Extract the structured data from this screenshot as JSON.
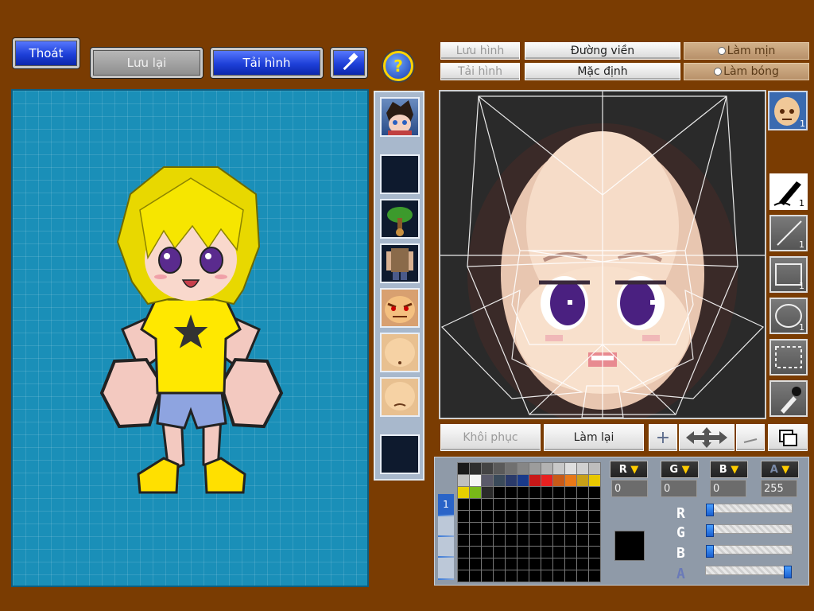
{
  "toolbar": {
    "exit_label": "Thoát",
    "save_label": "Lưu lại",
    "reload_label": "Tải hình",
    "help_symbol": "?"
  },
  "editor_toolbar": {
    "save_image_label": "Lưu hình",
    "load_image_label": "Tải hình",
    "outline_label": "Đường viền",
    "default_label": "Mặc định",
    "smooth_label": "Làm mịn",
    "shine_label": "Làm bóng"
  },
  "face_thumb_count": "1",
  "tools": [
    {
      "name": "pen",
      "count": "1"
    },
    {
      "name": "line",
      "count": "1"
    },
    {
      "name": "rectangle",
      "count": "1"
    },
    {
      "name": "ellipse",
      "count": "1"
    },
    {
      "name": "select",
      "count": ""
    },
    {
      "name": "eyedropper",
      "count": ""
    }
  ],
  "actions": {
    "restore_label": "Khôi phục",
    "redo_label": "Làm lại",
    "add_symbol": "+"
  },
  "color": {
    "r_label": "R",
    "g_label": "G",
    "b_label": "B",
    "a_label": "A",
    "r": "0",
    "g": "0",
    "b": "0",
    "a": "255",
    "r_level": 0,
    "g_level": 0,
    "b_level": 0,
    "a_level": 1,
    "current_hex": "#000000"
  },
  "palette_tab": "1",
  "palette": [
    "#1a1a1a",
    "#2e2e2e",
    "#444444",
    "#5a5a5a",
    "#707070",
    "#868686",
    "#9c9c9c",
    "#b2b2b2",
    "#c8c8c8",
    "#dedede",
    "#d0d0d0",
    "#bdbdbd",
    "#c0c0c0",
    "#f5f5f5",
    "#5a5a6a",
    "#3a4a5a",
    "#2a3a6a",
    "#1a3a8a",
    "#c81818",
    "#e82020",
    "#c85a18",
    "#e87818",
    "#c8a018",
    "#e8c800",
    "#e8d000",
    "#78b818",
    "#2a2a2a"
  ],
  "theme": {
    "background": "#7a3c02",
    "accent_blue": "#1d3fd8",
    "canvas_blue": "#1a8fb8"
  }
}
